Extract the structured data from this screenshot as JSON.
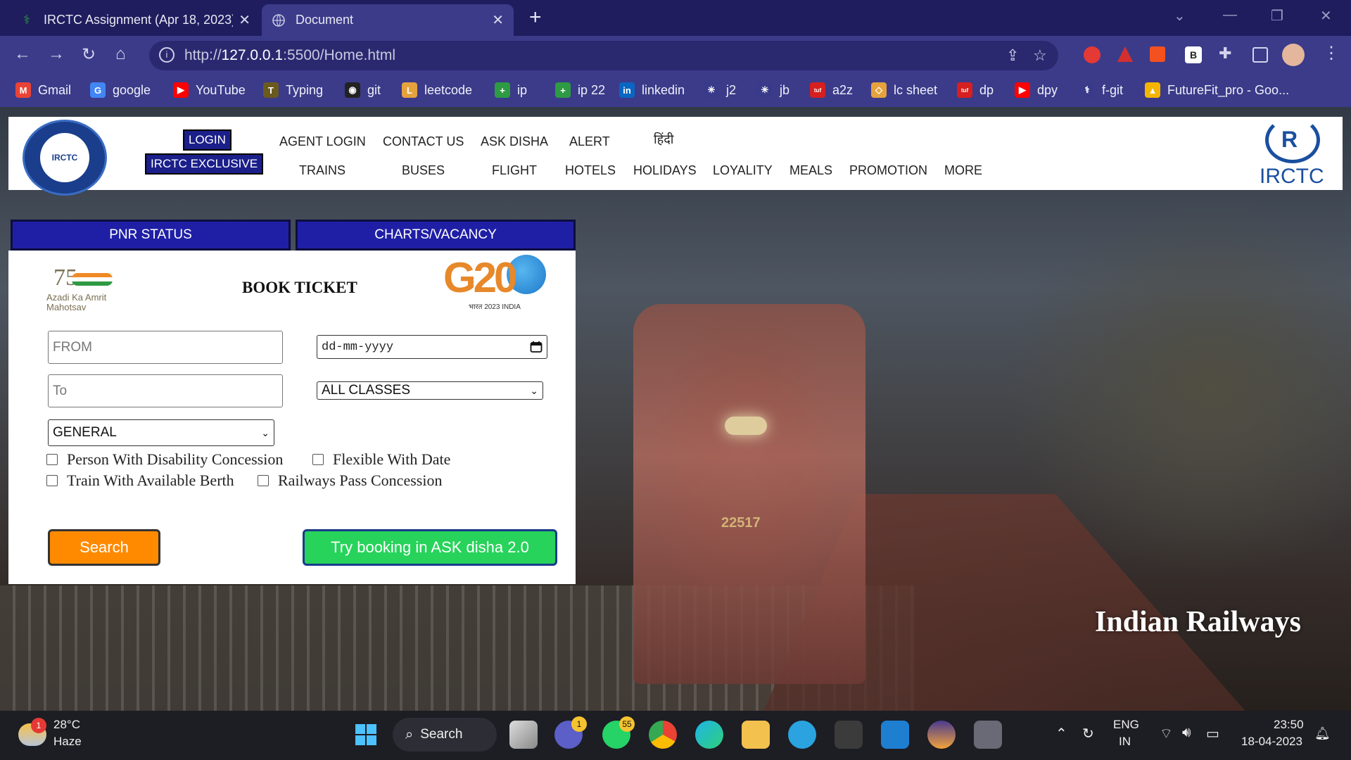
{
  "browser": {
    "tabs": [
      {
        "title": "IRCTC Assignment (Apr 18, 2023)",
        "close": "✕"
      },
      {
        "title": "Document",
        "close": "✕"
      }
    ],
    "new_tab": "+",
    "url_host": "127.0.0.1",
    "url_prefix": "http://",
    "url_path": ":5500/Home.html",
    "bookmarks": [
      {
        "label": "Gmail",
        "icon": "gmail-icon",
        "color": "#ea4335",
        "glyph": "M"
      },
      {
        "label": "google",
        "icon": "google-icon",
        "color": "#4285f4",
        "glyph": "G"
      },
      {
        "label": "YouTube",
        "icon": "youtube-icon",
        "color": "#ff0000",
        "glyph": "▶"
      },
      {
        "label": "Typing",
        "icon": "typing-icon",
        "color": "#6b5a1e",
        "glyph": "T"
      },
      {
        "label": "git",
        "icon": "github-icon",
        "color": "#222",
        "glyph": "◉"
      },
      {
        "label": "leetcode",
        "icon": "leetcode-icon",
        "color": "#e6a23c",
        "glyph": "L"
      },
      {
        "label": "ip",
        "icon": "plus-icon",
        "color": "#2e9a43",
        "glyph": "+"
      },
      {
        "label": "ip 22",
        "icon": "plus-icon",
        "color": "#2e9a43",
        "glyph": "+"
      },
      {
        "label": "linkedin",
        "icon": "linkedin-icon",
        "color": "#0a66c2",
        "glyph": "in"
      },
      {
        "label": "j2",
        "icon": "asterisk-icon",
        "color": "#3a3a8a",
        "glyph": "✳"
      },
      {
        "label": "jb",
        "icon": "asterisk-icon",
        "color": "#3a3a8a",
        "glyph": "✳"
      },
      {
        "label": "a2z",
        "icon": "tuf-icon",
        "color": "#d61f1f",
        "glyph": "tuf"
      },
      {
        "label": "lc sheet",
        "icon": "leetcode-icon",
        "color": "#e6a23c",
        "glyph": "◇"
      },
      {
        "label": "dp",
        "icon": "tuf-icon",
        "color": "#d61f1f",
        "glyph": "tuf"
      },
      {
        "label": "dpy",
        "icon": "youtube-icon",
        "color": "#ff0000",
        "glyph": "▶"
      },
      {
        "label": "f-git",
        "icon": "f-git-icon",
        "color": "#3a3a8a",
        "glyph": "⚕"
      },
      {
        "label": "FutureFit_pro - Goo...",
        "icon": "drive-icon",
        "color": "#f4b400",
        "glyph": "▲"
      }
    ]
  },
  "header": {
    "login": "LOGIN",
    "exclusive": "IRCTC EXCLUSIVE",
    "top_links": [
      "AGENT LOGIN",
      "CONTACT US",
      "ASK DISHA",
      "ALERT",
      "हिंदी"
    ],
    "bottom_links": [
      "TRAINS",
      "BUSES",
      "FLIGHT",
      "HOTELS",
      "HOLIDAYS",
      "LOYALITY",
      "MEALS",
      "PROMOTION",
      "MORE"
    ],
    "logo_right_text": "IRCTC",
    "logo_left_text": "IRCTC"
  },
  "tabs": {
    "pnr": "PNR STATUS",
    "charts": "CHARTS/VACANCY"
  },
  "booking": {
    "azadi_number": "75",
    "azadi_words": "Azadi Ka Amrit Mahotsav",
    "title": "BOOK TICKET",
    "g20_text": "G20",
    "g20_sub": "भारत 2023 INDIA",
    "from_placeholder": "FROM",
    "to_placeholder": "To",
    "date_placeholder": "dd-mm-yyyy",
    "class_value": "ALL CLASSES",
    "quota_value": "GENERAL",
    "checkboxes": [
      "Person With Disability Concession",
      "Flexible With Date",
      "Train With Available Berth",
      "Railways Pass Concession"
    ],
    "search_label": "Search",
    "disha_label": "Try booking in ASK disha 2.0"
  },
  "hero": {
    "sign": "Indian Railways",
    "train_number": "22517"
  },
  "taskbar": {
    "weather_temp": "28°C",
    "weather_desc": "Haze",
    "weather_badge": "1",
    "search_label": "Search",
    "teams_badge": "1",
    "whatsapp_badge": "55",
    "lang_top": "ENG",
    "lang_bottom": "IN",
    "time": "23:50",
    "date": "18-04-2023"
  }
}
